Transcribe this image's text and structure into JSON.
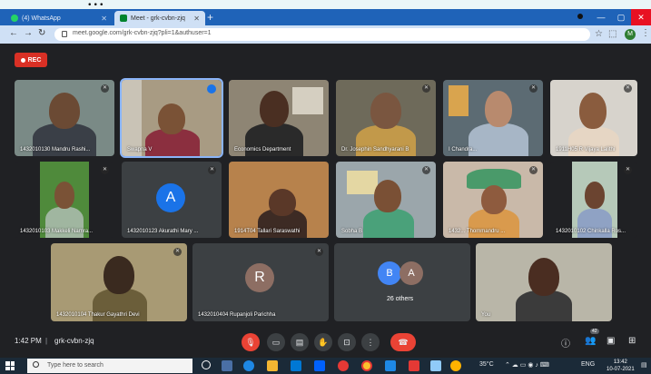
{
  "caption": {
    "text": "..."
  },
  "browser": {
    "tabs": [
      {
        "label": "(4) WhatsApp"
      },
      {
        "label": "Meet - grk-cvbn-zjq"
      }
    ],
    "url": "meet.google.com/grk-cvbn-zjq?pli=1&authuser=1",
    "profile_initial": "M"
  },
  "meet": {
    "rec_label": "REC",
    "tiles": [
      {
        "label": "1432010130 Mandru Rashi..."
      },
      {
        "label": "Swapna V"
      },
      {
        "label": "Economics Department"
      },
      {
        "label": "Dr. Josephin Sandhyarani B"
      },
      {
        "label": "I Chandra..."
      },
      {
        "label": "1911H05 R Vijaya Lalithi"
      },
      {
        "label": "1432010103 Makkeli Namra..."
      },
      {
        "label": "1432010123 Akurathi Mary ...",
        "initial": "A"
      },
      {
        "label": "1914T04 Tallari Saraswathi"
      },
      {
        "label": "Sobha B"
      },
      {
        "label": "1432... Thommandru ..."
      },
      {
        "label": "1432010102 Chinkalla Ros..."
      },
      {
        "label": "1432010104 Thakur Gayathri Devi"
      },
      {
        "label": "1432010404 Rupanjoli Parichha",
        "initial": "R"
      },
      {
        "label": "26 others",
        "initials": [
          "B",
          "A"
        ]
      },
      {
        "label": "You"
      }
    ]
  },
  "controls": {
    "time": "1:42 PM",
    "separator": "|",
    "meeting_code": "grk-cvbn-zjq",
    "people_count": "42"
  },
  "taskbar": {
    "search_placeholder": "Type here to search",
    "temperature": "35°C",
    "language": "ENG",
    "clock_time": "13:42",
    "clock_date": "10-07-2021"
  },
  "colors": {
    "meet_bg": "#202124",
    "tile_bg": "#3c4043",
    "rec_red": "#d93025",
    "hangup_red": "#ea4335",
    "chrome_blue": "#1f63b8",
    "highlight": "#8ab4f8"
  }
}
